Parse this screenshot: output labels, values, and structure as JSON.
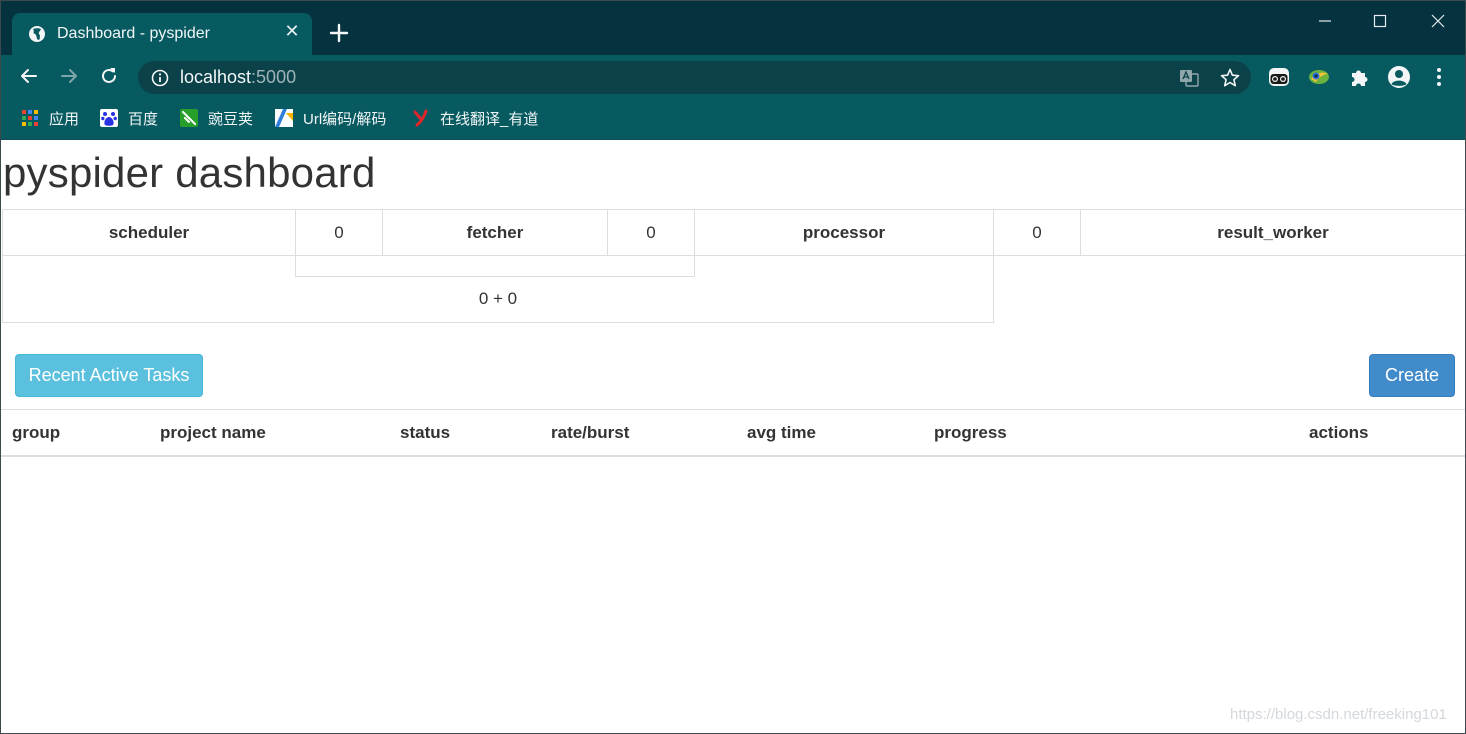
{
  "browser": {
    "tab_title": "Dashboard - pyspider",
    "url_host": "localhost",
    "url_port": ":5000",
    "bookmarks": [
      {
        "label": "应用",
        "icon": "apps-grid-icon"
      },
      {
        "label": "百度",
        "icon": "baidu-paw-icon"
      },
      {
        "label": "豌豆荚",
        "icon": "wandoujia-icon"
      },
      {
        "label": "Url编码/解码",
        "icon": "url-codec-icon"
      },
      {
        "label": "在线翻译_有道",
        "icon": "youdao-icon"
      }
    ],
    "icons": [
      "globe-icon",
      "close-icon",
      "plus-icon",
      "minimize-icon",
      "maximize-icon",
      "window-close-icon",
      "back-arrow-icon",
      "forward-arrow-icon",
      "reload-icon",
      "info-icon",
      "translate-icon",
      "star-icon",
      "incognito-glasses-icon",
      "colorful-extension-icon",
      "puzzle-extension-icon",
      "account-icon",
      "menu-dots-icon"
    ]
  },
  "page": {
    "title": "pyspider dashboard",
    "stats": {
      "scheduler_label": "scheduler",
      "scheduler_value": "0",
      "fetcher_label": "fetcher",
      "fetcher_value": "0",
      "processor_label": "processor",
      "processor_value": "0",
      "result_worker_label": "result_worker",
      "fetcher_total": "0 + 0"
    },
    "buttons": {
      "recent_active_tasks": "Recent Active Tasks",
      "create": "Create"
    },
    "table": {
      "columns": [
        "group",
        "project name",
        "status",
        "rate/burst",
        "avg time",
        "progress",
        "actions"
      ],
      "rows": []
    },
    "watermark": "https://blog.csdn.net/freeking101"
  },
  "colors": {
    "tabstrip": "#04333f",
    "toolbar": "#065a60",
    "btn_info": "#5bc0de",
    "btn_primary": "#428bca"
  }
}
